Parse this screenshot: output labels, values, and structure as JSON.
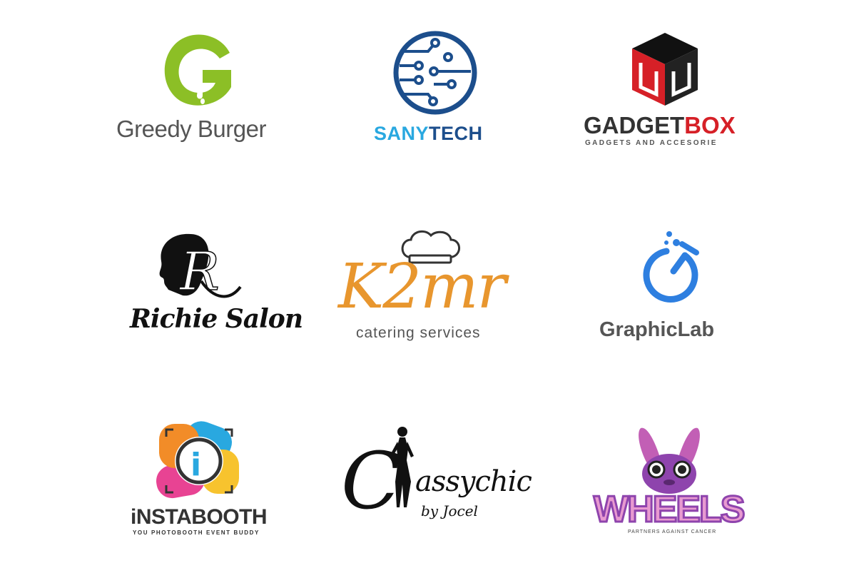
{
  "logos": [
    {
      "id": "greedy-burger",
      "name": "Greedy Burger",
      "color": "#8cbf26",
      "text_color": "#555555"
    },
    {
      "id": "sanytech",
      "name_part1": "SANY",
      "name_part2": "TECH",
      "color1": "#29a8e0",
      "color2": "#1c4e8c"
    },
    {
      "id": "gadgetbox",
      "name_part1": "GADGET",
      "name_part2": "BOX",
      "tagline": "GADGETS AND ACCESORIE",
      "color1": "#333333",
      "color2": "#d62027"
    },
    {
      "id": "richie-salon",
      "name": "Richie Salon",
      "monogram": "R",
      "color": "#111111"
    },
    {
      "id": "k2mr",
      "name": "K2mr",
      "tagline": "catering services",
      "color": "#e8962e",
      "tagline_color": "#555555"
    },
    {
      "id": "graphiclab",
      "name": "GraphicLab",
      "color": "#2e7fe0",
      "text_color": "#555555"
    },
    {
      "id": "instabooth",
      "name": "iNSTABOOTH",
      "tagline": "YOU PHOTOBOOTH EVENT BUDDY",
      "color": "#333333",
      "accent": "#29a8e0"
    },
    {
      "id": "classychic",
      "name_initial": "C",
      "name_rest": "assychic",
      "signature": "by Jocel",
      "color": "#111111"
    },
    {
      "id": "wheels",
      "name": "WHEELS",
      "tagline": "PARTNERS AGAINST CANCER",
      "color": "#e89ad0",
      "accent": "#8e44ad"
    }
  ]
}
